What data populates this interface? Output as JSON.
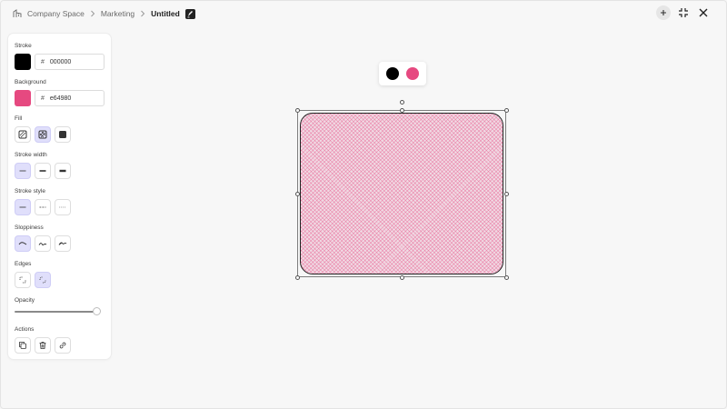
{
  "breadcrumb": {
    "items": [
      "Company Space",
      "Marketing",
      "Untitled"
    ]
  },
  "window_controls": {
    "icons": [
      "plus-icon",
      "minimize-icon",
      "close-icon"
    ]
  },
  "panel": {
    "stroke": {
      "label": "Stroke",
      "hash": "#",
      "value": "000000",
      "color": "#000000"
    },
    "background": {
      "label": "Background",
      "hash": "#",
      "value": "e64980",
      "color": "#e64980"
    },
    "fill": {
      "label": "Fill",
      "options": [
        "hachure",
        "cross-hatch",
        "solid"
      ],
      "selected": "cross-hatch"
    },
    "stroke_width": {
      "label": "Stroke width",
      "options": [
        "thin",
        "bold",
        "extra-bold"
      ],
      "selected": "thin"
    },
    "stroke_style": {
      "label": "Stroke style",
      "options": [
        "solid",
        "dashed",
        "dotted"
      ],
      "selected": "solid"
    },
    "sloppiness": {
      "label": "Sloppiness",
      "options": [
        "architect",
        "artist",
        "cartoonist"
      ],
      "selected": "architect"
    },
    "edges": {
      "label": "Edges",
      "options": [
        "sharp",
        "round"
      ],
      "selected": "round"
    },
    "opacity": {
      "label": "Opacity",
      "value": 1.0
    },
    "actions": {
      "label": "Actions",
      "items": [
        "duplicate",
        "delete",
        "link"
      ]
    }
  },
  "canvas": {
    "popover_colors": [
      "#000000",
      "#e64980"
    ],
    "shape": {
      "type": "rectangle",
      "stroke": "#000000",
      "fill": "#e64980",
      "fill_style": "cross-hatch",
      "edges": "round"
    }
  }
}
